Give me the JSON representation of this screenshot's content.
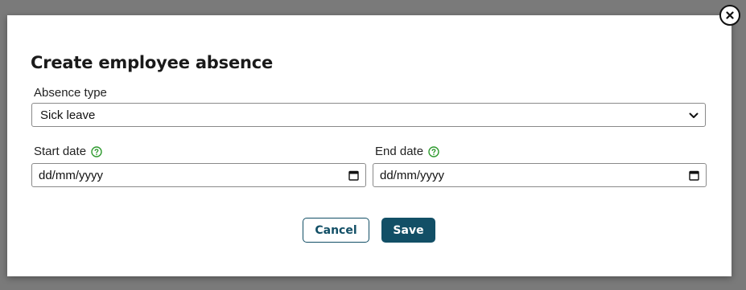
{
  "dialog": {
    "title": "Create employee absence",
    "close_icon": "close-icon"
  },
  "absence_type": {
    "label": "Absence type",
    "value": "Sick leave",
    "icon": "chevron-down-icon"
  },
  "start_date": {
    "label": "Start date",
    "placeholder": "dd/mm/yyyy",
    "help_icon": "help-circle-icon",
    "calendar_icon": "calendar-icon"
  },
  "end_date": {
    "label": "End date",
    "placeholder": "dd/mm/yyyy",
    "help_icon": "help-circle-icon",
    "calendar_icon": "calendar-icon"
  },
  "actions": {
    "cancel_label": "Cancel",
    "save_label": "Save"
  },
  "colors": {
    "primary": "#124f66",
    "help_icon": "#2e9a2e",
    "overlay": "#7a7a7a"
  }
}
